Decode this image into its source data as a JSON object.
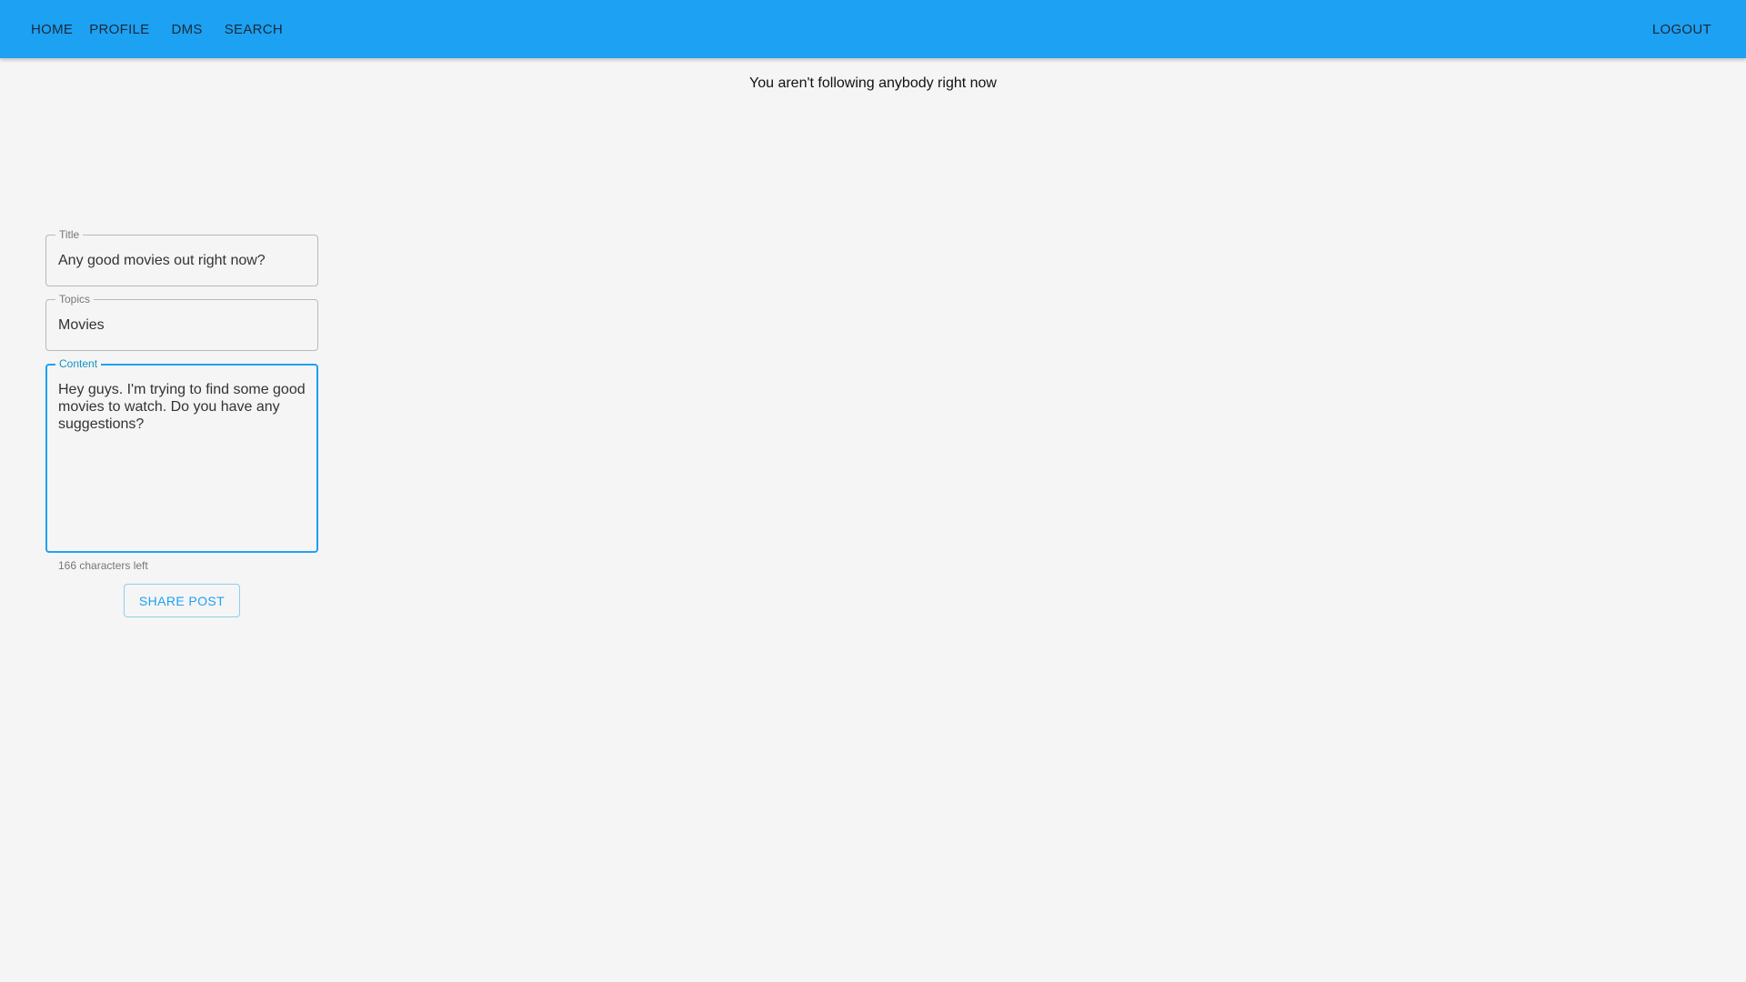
{
  "nav": {
    "items": [
      {
        "label": "HOME"
      },
      {
        "label": "PROFILE"
      },
      {
        "label": "DMS"
      },
      {
        "label": "SEARCH"
      }
    ],
    "logout_label": "LOGOUT"
  },
  "feed": {
    "empty_message": "You aren't following anybody right now"
  },
  "form": {
    "title_label": "Title",
    "title_value": "Any good movies out right now?",
    "topics_label": "Topics",
    "topics_value": "Movies",
    "content_label": "Content",
    "content_value": "Hey guys. I'm trying to find some good movies to watch. Do you have any suggestions?",
    "helper_text": "166 characters left",
    "share_label": "SHARE POST"
  },
  "colors": {
    "app_bar": "#1da1f2",
    "background": "#f5f5f5",
    "focus_border": "#1da1f2"
  }
}
